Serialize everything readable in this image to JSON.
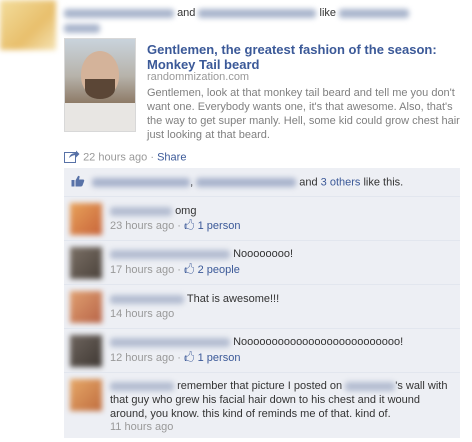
{
  "post": {
    "connector_and": "and",
    "connector_like": "like",
    "link": {
      "title": "Gentlemen, the greatest fashion of the season: Monkey Tail beard",
      "domain": "randommization.com",
      "description": "Gentlemen, look at that monkey tail beard and tell me you don't want one. Everybody wants one, it's that awesome. Also, that's the way to get super manly. Hell, some kid could grow chest hair just looking at that beard."
    },
    "timestamp": "22 hours ago",
    "separator": "·",
    "share_label": "Share"
  },
  "likes": {
    "comma": ",",
    "and": "and",
    "others": "3 others",
    "suffix": "like this."
  },
  "comments": [
    {
      "text": "omg",
      "time": "23 hours ago",
      "likes": "1 person"
    },
    {
      "text": "Noooooooo!",
      "time": "17 hours ago",
      "likes": "2 people"
    },
    {
      "text": "That is awesome!!!",
      "time": "14 hours ago",
      "likes": ""
    },
    {
      "text": "Noooooooooooooooooooooooooo!",
      "time": "12 hours ago",
      "likes": "1 person"
    },
    {
      "text_before": "remember that picture I posted on",
      "text_after": "'s wall with that guy who grew his facial hair down to his chest and it wound around, you know. this kind of reminds me of that. kind of.",
      "time": "11 hours ago"
    }
  ],
  "colors": {
    "link": "#3b5998",
    "ufi_bg": "#edeff4",
    "muted": "#999999"
  },
  "icons": [
    "share-icon",
    "thumbs-up-icon"
  ]
}
